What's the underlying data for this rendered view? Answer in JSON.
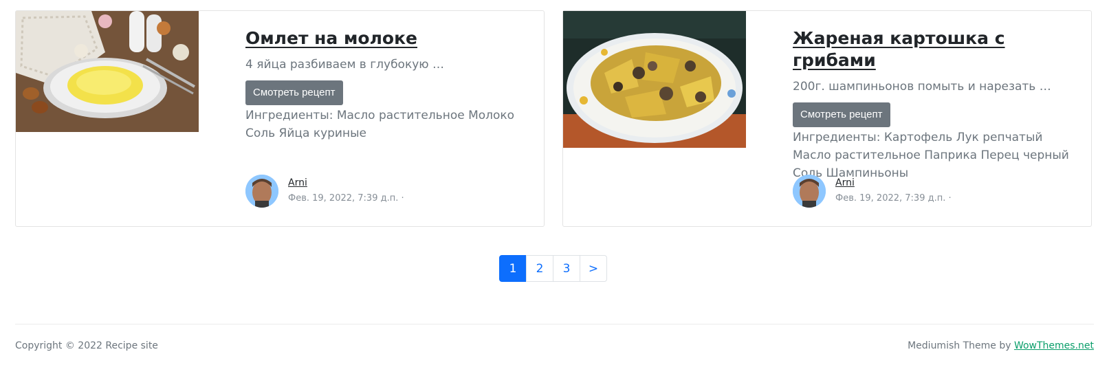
{
  "cards": [
    {
      "title": "Омлет на молоке",
      "excerpt": "4 яйца разбиваем в глубокую …",
      "button_label": "Смотреть рецепт",
      "ingredients": "Ингредиенты: Масло растительное Молоко Соль Яйца куриные",
      "author": "Arni",
      "date": "Фев. 19, 2022, 7:39 д.п. ·"
    },
    {
      "title": "Жареная картошка с грибами",
      "excerpt": "200г. шампиньонов помыть и нарезать …",
      "button_label": "Смотреть рецепт",
      "ingredients": "Ингредиенты: Картофель Лук репчатый Масло растительное Паприка Перец черный Соль Шампиньоны",
      "author": "Arni",
      "date": "Фев. 19, 2022, 7:39 д.п. ·"
    }
  ],
  "pagination": {
    "pages": [
      "1",
      "2",
      "3"
    ],
    "next": ">",
    "active": "1"
  },
  "footer": {
    "copyright": "Copyright © 2022 Recipe site",
    "theme_prefix": "Mediumish Theme by",
    "theme_link": "WowThemes.net"
  },
  "colors": {
    "primary": "#0d6efd",
    "secondary": "#6c757d",
    "link_green": "#0a9e6a"
  }
}
